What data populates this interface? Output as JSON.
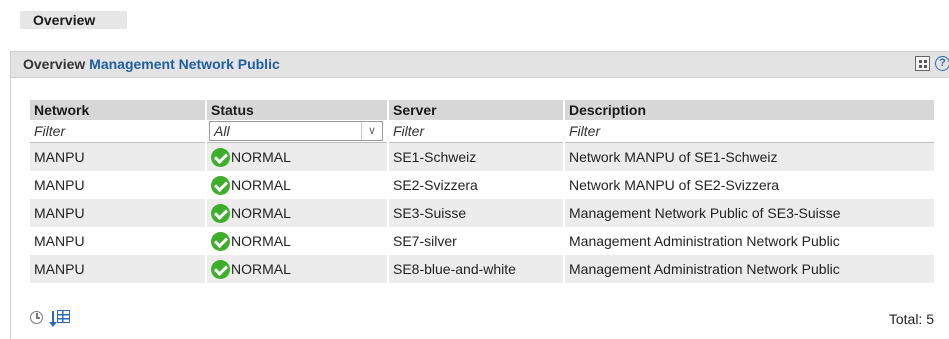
{
  "tab": {
    "label": "Overview"
  },
  "panel": {
    "title_prefix": "Overview",
    "title_link": "Management Network Public"
  },
  "table": {
    "columns": [
      "Network",
      "Status",
      "Server",
      "Description"
    ],
    "filters": {
      "network": "Filter",
      "status": "All",
      "server": "Filter",
      "description": "Filter"
    },
    "rows": [
      {
        "network": "MANPU",
        "status": "NORMAL",
        "server": "SE1-Schweiz",
        "description": "Network MANPU of SE1-Schweiz"
      },
      {
        "network": "MANPU",
        "status": "NORMAL",
        "server": "SE2-Svizzera",
        "description": "Network MANPU of SE2-Svizzera"
      },
      {
        "network": "MANPU",
        "status": "NORMAL",
        "server": "SE3-Suisse",
        "description": "Management Network Public of SE3-Suisse"
      },
      {
        "network": "MANPU",
        "status": "NORMAL",
        "server": "SE7-silver",
        "description": "Management Administration Network Public"
      },
      {
        "network": "MANPU",
        "status": "NORMAL",
        "server": "SE8-blue-and-white",
        "description": "Management Administration Network Public"
      }
    ]
  },
  "footer": {
    "total": "Total: 5"
  },
  "colors": {
    "link": "#2a6ab8",
    "ok": "#3fae2a",
    "header_bg": "#e3e3e3",
    "row_alt": "#ececec"
  },
  "icons": {
    "layout": "grid-icon",
    "help": "help-icon",
    "status_ok": "check-circle-icon",
    "history": "clock-icon",
    "export": "export-table-icon"
  }
}
